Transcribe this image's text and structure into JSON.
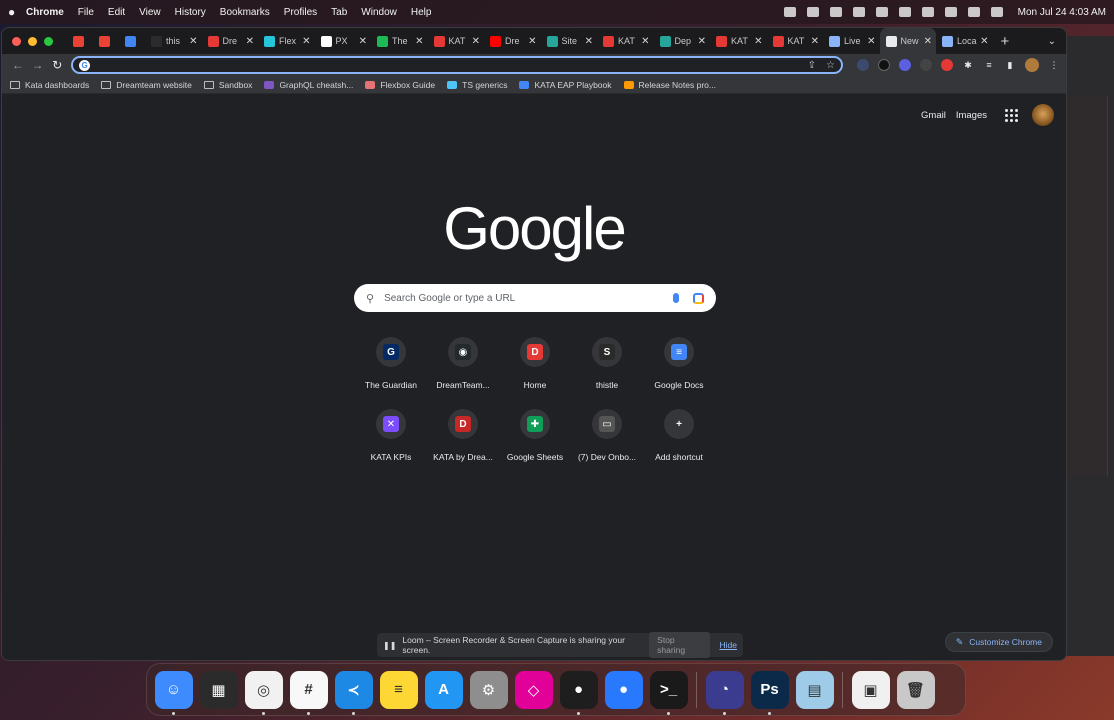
{
  "menubar": {
    "app_name": "Chrome",
    "items": [
      "File",
      "Edit",
      "View",
      "History",
      "Bookmarks",
      "Profiles",
      "Tab",
      "Window",
      "Help"
    ],
    "clock": "Mon Jul 24  4:03 AM"
  },
  "tabs": [
    {
      "title": "",
      "icon": "record-icon",
      "color": "#ea4335",
      "pinned": true
    },
    {
      "title": "",
      "icon": "gmail-icon",
      "color": "#ea4335",
      "pinned": true
    },
    {
      "title": "",
      "icon": "calendar-icon",
      "color": "#4285f4",
      "pinned": true
    },
    {
      "title": "this",
      "icon": "thistle-icon",
      "color": "#2b2b2b"
    },
    {
      "title": "Dre",
      "icon": "dreamteam-icon",
      "color": "#e53935"
    },
    {
      "title": "Flex",
      "icon": "flex-icon",
      "color": "#26c6da"
    },
    {
      "title": "PX",
      "icon": "px-icon",
      "color": "#ffffff"
    },
    {
      "title": "The",
      "icon": "spotify-icon",
      "color": "#1db954"
    },
    {
      "title": "KAT",
      "icon": "kata-icon",
      "color": "#e53935"
    },
    {
      "title": "Dre",
      "icon": "youtube-icon",
      "color": "#ff0000"
    },
    {
      "title": "Site",
      "icon": "site-icon",
      "color": "#26a69a"
    },
    {
      "title": "KAT",
      "icon": "kata-icon",
      "color": "#e53935"
    },
    {
      "title": "Dep",
      "icon": "deploy-icon",
      "color": "#26a69a"
    },
    {
      "title": "KAT",
      "icon": "kata-icon",
      "color": "#e53935"
    },
    {
      "title": "KAT",
      "icon": "kata-icon",
      "color": "#e53935"
    },
    {
      "title": "Live",
      "icon": "live-icon",
      "color": "#8ab4f8"
    },
    {
      "title": "New",
      "icon": "chrome-icon",
      "color": "#e8eaed",
      "active": true
    },
    {
      "title": "Loca",
      "icon": "react-icon",
      "color": "#8ab4f8"
    }
  ],
  "omnibox": {
    "value": "",
    "placeholder": ""
  },
  "bookmarks": [
    {
      "label": "Kata dashboards",
      "icon": "folder-icon"
    },
    {
      "label": "Dreamteam website",
      "icon": "folder-icon"
    },
    {
      "label": "Sandbox",
      "icon": "folder-icon"
    },
    {
      "label": "GraphQL cheatsh...",
      "icon": "graphql-icon",
      "color": "#7e57c2"
    },
    {
      "label": "Flexbox Guide",
      "icon": "asterisk-icon",
      "color": "#e57373"
    },
    {
      "label": "TS generics",
      "icon": "ts-icon",
      "color": "#4fc3f7"
    },
    {
      "label": "KATA EAP Playbook",
      "icon": "docs-icon",
      "color": "#4285f4"
    },
    {
      "label": "Release Notes pro...",
      "icon": "amazon-icon",
      "color": "#ff9900"
    }
  ],
  "top_links": {
    "gmail": "Gmail",
    "images": "Images"
  },
  "logo": "Google",
  "search": {
    "placeholder": "Search Google or type a URL"
  },
  "shortcuts": [
    {
      "label": "The Guardian",
      "glyph": "G",
      "color": "#052962"
    },
    {
      "label": "DreamTeam...",
      "glyph": "◉",
      "color": "#24292e"
    },
    {
      "label": "Home",
      "glyph": "D",
      "color": "#e53935"
    },
    {
      "label": "thistle",
      "glyph": "S",
      "color": "#2a2a2a"
    },
    {
      "label": "Google Docs",
      "glyph": "≡",
      "color": "#4285f4"
    },
    {
      "label": "KATA KPIs",
      "glyph": "✕",
      "color": "#7c4dff"
    },
    {
      "label": "KATA by Drea...",
      "glyph": "D",
      "color": "#c62828"
    },
    {
      "label": "Google Sheets",
      "glyph": "✚",
      "color": "#0f9d58"
    },
    {
      "label": "(7) Dev Onbo...",
      "glyph": "▭",
      "color": "#555555"
    },
    {
      "label": "Add shortcut",
      "glyph": "+",
      "color": "#35363a"
    }
  ],
  "loom": {
    "message": "Loom – Screen Recorder & Screen Capture is sharing your screen.",
    "stop_label": "Stop sharing",
    "hide_label": "Hide"
  },
  "customize": {
    "label": "Customize Chrome"
  },
  "dock": [
    {
      "name": "finder",
      "glyph": "☺",
      "color": "#3d8bfd",
      "running": true
    },
    {
      "name": "mission-control",
      "glyph": "▦",
      "color": "#2b2b2b",
      "running": false
    },
    {
      "name": "chrome",
      "glyph": "◎",
      "color": "#f1f1f1",
      "running": true
    },
    {
      "name": "slack",
      "glyph": "#",
      "color": "#f8f8f8",
      "running": true
    },
    {
      "name": "vscode",
      "glyph": "≺",
      "color": "#1e88e5",
      "running": true
    },
    {
      "name": "notes",
      "glyph": "≡",
      "color": "#fdd835",
      "running": false
    },
    {
      "name": "app-store",
      "glyph": "A",
      "color": "#2196f3",
      "running": false
    },
    {
      "name": "system-settings",
      "glyph": "⚙",
      "color": "#8e8e8e",
      "running": false
    },
    {
      "name": "graphql",
      "glyph": "◇",
      "color": "#e10098",
      "running": false
    },
    {
      "name": "figma",
      "glyph": "●",
      "color": "#1e1e1e",
      "running": true
    },
    {
      "name": "maps",
      "glyph": "●",
      "color": "#2979ff",
      "running": false
    },
    {
      "name": "terminal",
      "glyph": ">_",
      "color": "#1a1a1a",
      "running": true
    },
    {
      "name": "arc",
      "glyph": "◔",
      "color": "#3b3b8f",
      "running": true
    },
    {
      "name": "photoshop",
      "glyph": "Ps",
      "color": "#0b2a4a",
      "running": true
    },
    {
      "name": "preview",
      "glyph": "▤",
      "color": "#9ecbe8",
      "running": false
    },
    {
      "name": "downloads",
      "glyph": "▣",
      "color": "#f0f0f0",
      "running": false
    },
    {
      "name": "trash",
      "glyph": "🗑",
      "color": "#c8c8c8",
      "running": false
    }
  ]
}
